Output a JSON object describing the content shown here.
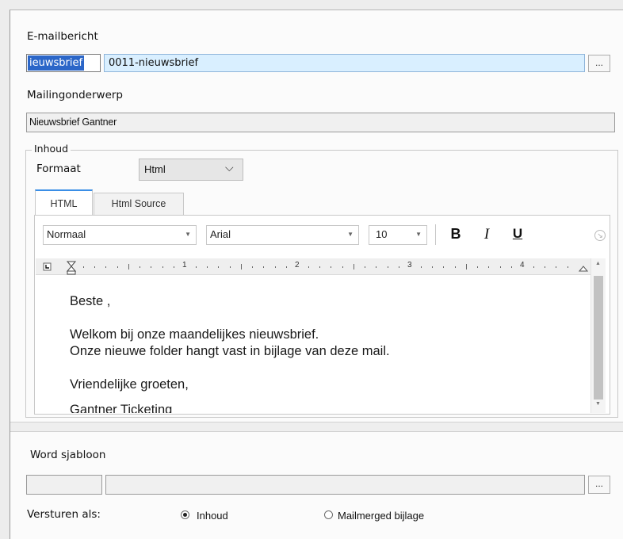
{
  "email": {
    "label": "E-mailbericht",
    "code": "ieuwsbrief",
    "name": "0011-nieuwsbrief",
    "browse_label": "..."
  },
  "subject": {
    "label": "Mailingonderwerp",
    "value": "Nieuwsbrief Gantner"
  },
  "content": {
    "legend": "Inhoud",
    "format_label": "Formaat",
    "format_value": "Html",
    "tabs": [
      {
        "label": "HTML",
        "active": true
      },
      {
        "label": "Html Source",
        "active": false
      }
    ],
    "toolbar": {
      "style_value": "Normaal",
      "font_value": "Arial",
      "size_value": "10",
      "bold_label": "B",
      "italic_label": "I",
      "underline_label": "U"
    },
    "ruler_numbers": [
      "1",
      "2",
      "3",
      "4"
    ],
    "body_lines": [
      "Beste ,",
      "",
      "Welkom bij onze maandelijkes nieuwsbrief.",
      "Onze nieuwe folder hangt vast in bijlage van deze mail.",
      "",
      "Vriendelijke groeten,",
      "Gantner Ticketing"
    ]
  },
  "word_template": {
    "label": "Word sjabloon",
    "code": "",
    "name": "",
    "browse_label": "..."
  },
  "send_as": {
    "label": "Versturen als:",
    "options": [
      {
        "label": "Inhoud",
        "selected": true
      },
      {
        "label": "Mailmerged bijlage",
        "selected": false
      }
    ]
  },
  "colors": {
    "selection": "#2b66c8",
    "field_highlight": "#d9efff",
    "tab_active_border": "#3a8ee6"
  }
}
